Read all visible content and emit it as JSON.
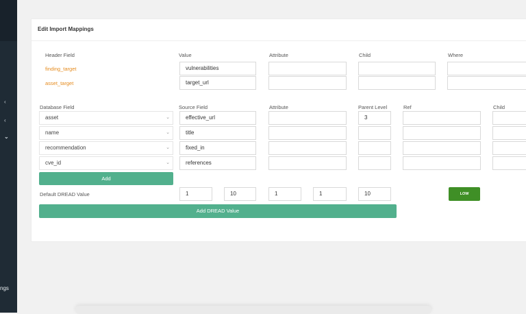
{
  "page": {
    "title": "Edit Import Mappings"
  },
  "sidebar": {
    "chevrons": [
      "‹",
      "‹",
      "⌄"
    ],
    "partial_item": "ngs"
  },
  "header_section": {
    "columns": [
      "Header Field",
      "Value",
      "Attribute",
      "Child",
      "Where"
    ],
    "rows": [
      {
        "field": "finding_target",
        "value": "vulnerabilities"
      },
      {
        "field": "asset_target",
        "value": "target_url"
      }
    ]
  },
  "db_section": {
    "columns": [
      "Database Field",
      "Source Field",
      "Attribute",
      "Parent Level",
      "Ref",
      "Child"
    ],
    "rows": [
      {
        "field": "asset",
        "source": "effective_url",
        "parent_level": "3"
      },
      {
        "field": "name",
        "source": "title",
        "parent_level": ""
      },
      {
        "field": "recommendation",
        "source": "fixed_in",
        "parent_level": ""
      },
      {
        "field": "cve_id",
        "source": "references",
        "parent_level": ""
      }
    ],
    "add_label": "Add"
  },
  "dread": {
    "label": "Default DREAD Value",
    "values": [
      "1",
      "10",
      "1",
      "1",
      "10"
    ],
    "rating": "LOW",
    "add_label": "Add DREAD Value"
  },
  "colors": {
    "accent": "#52b08d",
    "orange": "#e58a1c",
    "low": "#3f8f26",
    "sidebar": "#1f2b35"
  },
  "icons": {
    "select_caret": "chevron-down-icon"
  }
}
